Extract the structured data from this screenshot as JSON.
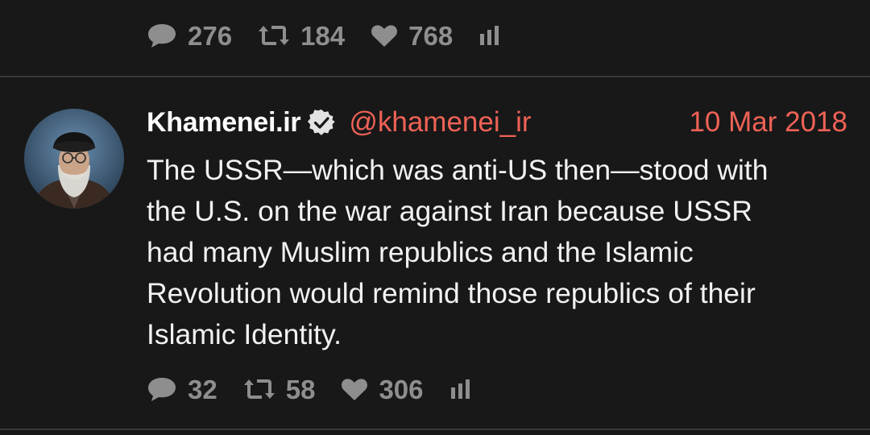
{
  "previous_tweet": {
    "stats": {
      "replies": "276",
      "retweets": "184",
      "likes": "768"
    }
  },
  "tweet": {
    "display_name": "Khamenei.ir",
    "handle": "@khamenei_ir",
    "date": "10 Mar 2018",
    "text": "The USSR—which was anti-US then—stood with\nthe U.S. on the war against Iran because USSR\nhad many Muslim republics and the Islamic\nRevolution would remind those republics of their\nIslamic Identity.",
    "stats": {
      "replies": "32",
      "retweets": "58",
      "likes": "306"
    }
  },
  "icons": {
    "reply": "speech-bubble-icon",
    "retweet": "retweet-icon",
    "like": "heart-icon",
    "analytics": "bar-chart-icon",
    "verified": "verified-check-icon"
  },
  "colors": {
    "background": "#181818",
    "accent": "#ef6256",
    "muted": "#8e8e8e"
  }
}
